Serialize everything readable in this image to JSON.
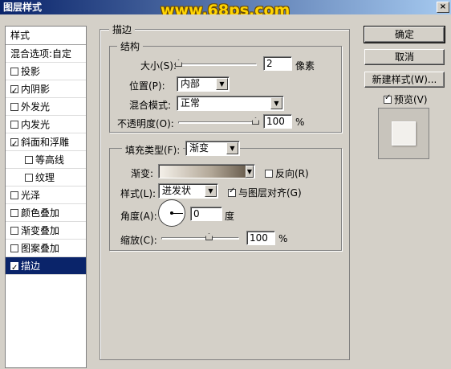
{
  "window": {
    "title": "图层样式",
    "watermark": "www.68ps.com",
    "close_glyph": "×"
  },
  "left_panel": {
    "header": "样式",
    "items": [
      {
        "label": "混合选项:自定",
        "checkbox": false,
        "checked": false,
        "indent": false,
        "selected": false
      },
      {
        "label": "投影",
        "checkbox": true,
        "checked": false,
        "indent": false,
        "selected": false
      },
      {
        "label": "内阴影",
        "checkbox": true,
        "checked": true,
        "indent": false,
        "selected": false
      },
      {
        "label": "外发光",
        "checkbox": true,
        "checked": false,
        "indent": false,
        "selected": false
      },
      {
        "label": "内发光",
        "checkbox": true,
        "checked": false,
        "indent": false,
        "selected": false
      },
      {
        "label": "斜面和浮雕",
        "checkbox": true,
        "checked": true,
        "indent": false,
        "selected": false
      },
      {
        "label": "等高线",
        "checkbox": true,
        "checked": false,
        "indent": true,
        "selected": false
      },
      {
        "label": "纹理",
        "checkbox": true,
        "checked": false,
        "indent": true,
        "selected": false
      },
      {
        "label": "光泽",
        "checkbox": true,
        "checked": false,
        "indent": false,
        "selected": false
      },
      {
        "label": "颜色叠加",
        "checkbox": true,
        "checked": false,
        "indent": false,
        "selected": false
      },
      {
        "label": "渐变叠加",
        "checkbox": true,
        "checked": false,
        "indent": false,
        "selected": false
      },
      {
        "label": "图案叠加",
        "checkbox": true,
        "checked": false,
        "indent": false,
        "selected": false
      },
      {
        "label": "描边",
        "checkbox": true,
        "checked": true,
        "indent": false,
        "selected": true
      }
    ]
  },
  "stroke": {
    "section_title": "描边",
    "structure": {
      "title": "结构",
      "size_label": "大小(S):",
      "size_value": "2",
      "size_unit": "像素",
      "position_label": "位置(P):",
      "position_value": "内部",
      "blend_label": "混合模式:",
      "blend_value": "正常",
      "opacity_label": "不透明度(O):",
      "opacity_value": "100",
      "opacity_unit": "%"
    },
    "fill": {
      "fill_type_label": "填充类型(F):",
      "fill_type_value": "渐变",
      "gradient_label": "渐变:",
      "reverse_label": "反向(R)",
      "reverse_checked": false,
      "style_label": "样式(L):",
      "style_value": "迸发状",
      "align_label": "与图层对齐(G)",
      "align_checked": true,
      "angle_label": "角度(A):",
      "angle_value": "0",
      "angle_unit": "度",
      "scale_label": "缩放(C):",
      "scale_value": "100",
      "scale_unit": "%"
    }
  },
  "buttons": {
    "ok": "确定",
    "cancel": "取消",
    "new_style": "新建样式(W)...",
    "preview_label": "预览(V)",
    "preview_checked": true
  },
  "colors": {
    "title_start": "#0a246a",
    "title_end": "#a6caf0",
    "selection": "#0a246a",
    "watermark": "#ffd400"
  }
}
